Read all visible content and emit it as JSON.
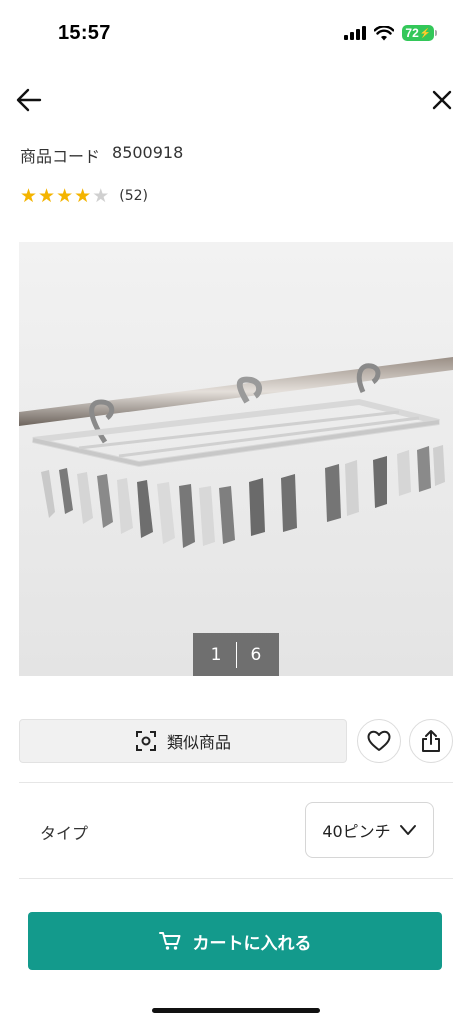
{
  "status": {
    "time": "15:57",
    "battery": "72"
  },
  "nav": {
    "back_icon": "arrow-left-icon",
    "close_icon": "close-icon"
  },
  "product": {
    "code_label": "商品コード",
    "code_value": "8500918",
    "rating": 4,
    "rating_max": 5,
    "review_count": "(52)",
    "image_subject": "hanger-with-clothespins"
  },
  "gallery": {
    "current": "1",
    "total": "6"
  },
  "actions": {
    "similar_label": "類似商品",
    "similar_icon": "scan-icon",
    "favorite_icon": "heart-icon",
    "share_icon": "share-icon"
  },
  "options": {
    "type_label": "タイプ",
    "type_value": "40ピンチ"
  },
  "cart": {
    "label": "カートに入れる",
    "icon": "cart-icon"
  },
  "colors": {
    "accent": "#139a8c",
    "star": "#f4b400",
    "battery": "#33c759"
  }
}
